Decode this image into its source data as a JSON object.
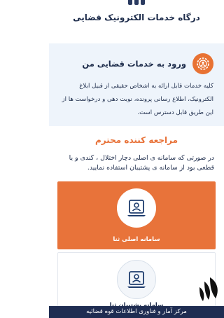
{
  "header": {
    "title": "درگاه خدمات الکترونیک قضایی"
  },
  "login_section": {
    "title": "ورود به خدمات قضایی من",
    "description": "کلیه خدمات قابل ارائه به اشخاص حقیقی از قبیل ابلاغ الکترونیک، اطلاع رسانی پرونده، نوبت دهی و درخواست ها از این طریق قابل دسترس است.",
    "icon": "gear-person-icon"
  },
  "notice": {
    "title": "مراجعه کننده محترم",
    "body": "در صورتی که سامانه ی اصلی دچار اختلال ، کندی و یا قطعی بود از سامانه ی پشتیبان استفاده نمایید."
  },
  "cards": [
    {
      "label": "سامانه اصلی ثنا",
      "icon": "user-monitor-icon"
    },
    {
      "label": "سامانه پشتیبان ثنا",
      "icon": "user-monitor-icon"
    }
  ],
  "footer": {
    "text": "مرکز آمار و فناوری اطلاعات قوه قضائیه"
  },
  "colors": {
    "accent": "#e8733a",
    "navy": "#1f2d52",
    "band_bg": "#eef4fb"
  }
}
